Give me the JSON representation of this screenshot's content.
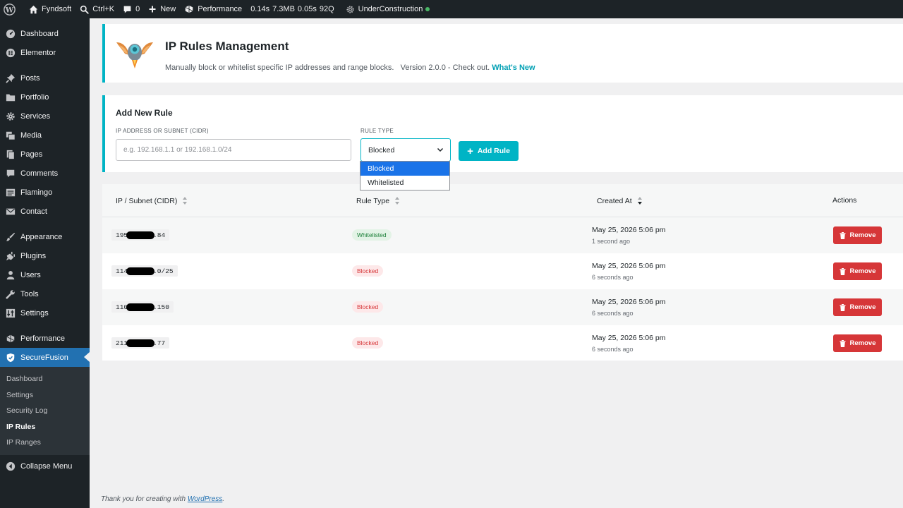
{
  "adminbar": {
    "site_name": "Fyndsoft",
    "search_shortcut": "Ctrl+K",
    "comments_count": "0",
    "new_label": "New",
    "performance_label": "Performance",
    "stats": [
      "0.14s",
      "7.3MB",
      "0.05s",
      "92Q"
    ],
    "maintenance_label": "UnderConstruction",
    "status_color": "#4ab866"
  },
  "sidebar": {
    "items": [
      {
        "label": "Dashboard",
        "icon": "dashboard-icon"
      },
      {
        "label": "Elementor",
        "icon": "elementor-icon"
      },
      {
        "label": "Posts",
        "icon": "pin-icon"
      },
      {
        "label": "Portfolio",
        "icon": "folder-icon"
      },
      {
        "label": "Services",
        "icon": "gear-icon"
      },
      {
        "label": "Media",
        "icon": "media-icon"
      },
      {
        "label": "Pages",
        "icon": "pages-icon"
      },
      {
        "label": "Comments",
        "icon": "comment-icon"
      },
      {
        "label": "Flamingo",
        "icon": "list-icon"
      },
      {
        "label": "Contact",
        "icon": "mail-icon"
      },
      {
        "label": "Appearance",
        "icon": "brush-icon"
      },
      {
        "label": "Plugins",
        "icon": "plug-icon"
      },
      {
        "label": "Users",
        "icon": "user-icon"
      },
      {
        "label": "Tools",
        "icon": "wrench-icon"
      },
      {
        "label": "Settings",
        "icon": "settings-icon"
      },
      {
        "label": "Performance",
        "icon": "performance-icon"
      },
      {
        "label": "SecureFusion",
        "icon": "shield-icon"
      }
    ],
    "submenu": [
      "Dashboard",
      "Settings",
      "Security Log",
      "IP Rules",
      "IP Ranges"
    ],
    "collapse_label": "Collapse Menu"
  },
  "header": {
    "title": "IP Rules Management",
    "subtitle": "Manually block or whitelist specific IP addresses and range blocks.",
    "version": "Version 2.0.0 - Check out.",
    "whats_new": "What's New"
  },
  "add_rule": {
    "title": "Add New Rule",
    "ip_label": "IP ADDRESS OR SUBNET (CIDR)",
    "ip_placeholder": "e.g. 192.168.1.1 or 192.168.1.0/24",
    "ip_value": "",
    "type_label": "RULE TYPE",
    "type_selected": "Blocked",
    "type_options": [
      "Blocked",
      "Whitelisted"
    ],
    "button_label": "Add Rule"
  },
  "table": {
    "columns": [
      "IP / Subnet (CIDR)",
      "Rule Type",
      "Created At",
      "Actions"
    ],
    "rows": [
      {
        "ip_start": "195",
        "ip_end": ".84",
        "type": "Whitelisted",
        "created": "May 25, 2026 5:06 pm",
        "ago": "1 second ago",
        "action": "Remove"
      },
      {
        "ip_start": "114",
        "ip_end": ".0/25",
        "type": "Blocked",
        "created": "May 25, 2026 5:06 pm",
        "ago": "6 seconds ago",
        "action": "Remove"
      },
      {
        "ip_start": "110",
        "ip_end": ".150",
        "type": "Blocked",
        "created": "May 25, 2026 5:06 pm",
        "ago": "6 seconds ago",
        "action": "Remove"
      },
      {
        "ip_start": "211",
        "ip_end": ".77",
        "type": "Blocked",
        "created": "May 25, 2026 5:06 pm",
        "ago": "6 seconds ago",
        "action": "Remove"
      }
    ]
  },
  "footer": {
    "text": "Thank you for creating with",
    "link": "WordPress",
    "end": "."
  },
  "colors": {
    "accent": "#00b4c5",
    "danger": "#d63638",
    "admin_dark": "#1d2327",
    "menu_active": "#2271b1"
  }
}
